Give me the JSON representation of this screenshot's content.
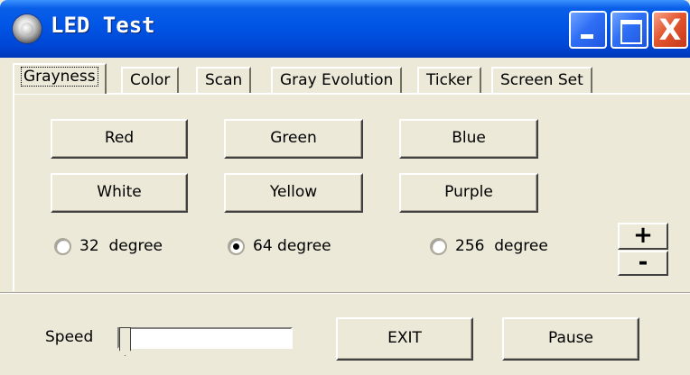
{
  "window": {
    "title": "LED Test"
  },
  "tabs": [
    {
      "label": "Grayness"
    },
    {
      "label": "Color"
    },
    {
      "label": "Scan"
    },
    {
      "label": "Gray Evolution"
    },
    {
      "label": "Ticker"
    },
    {
      "label": "Screen Set"
    }
  ],
  "color_buttons": [
    {
      "label": "Red"
    },
    {
      "label": "Green"
    },
    {
      "label": "Blue"
    },
    {
      "label": "White"
    },
    {
      "label": "Yellow"
    },
    {
      "label": "Purple"
    }
  ],
  "degree_options": [
    {
      "label": "32  degree",
      "checked": false
    },
    {
      "label": "64 degree",
      "checked": true
    },
    {
      "label": "256  degree",
      "checked": false
    }
  ],
  "stepper": {
    "plus": "+",
    "minus": "-"
  },
  "speed": {
    "label": "Speed"
  },
  "actions": {
    "exit": "EXIT",
    "pause": "Pause"
  },
  "title_buttons": {
    "close": "X"
  },
  "colors": {
    "titlebar": "#0055E5",
    "face": "#ECE9D8",
    "close": "#E2572F"
  }
}
